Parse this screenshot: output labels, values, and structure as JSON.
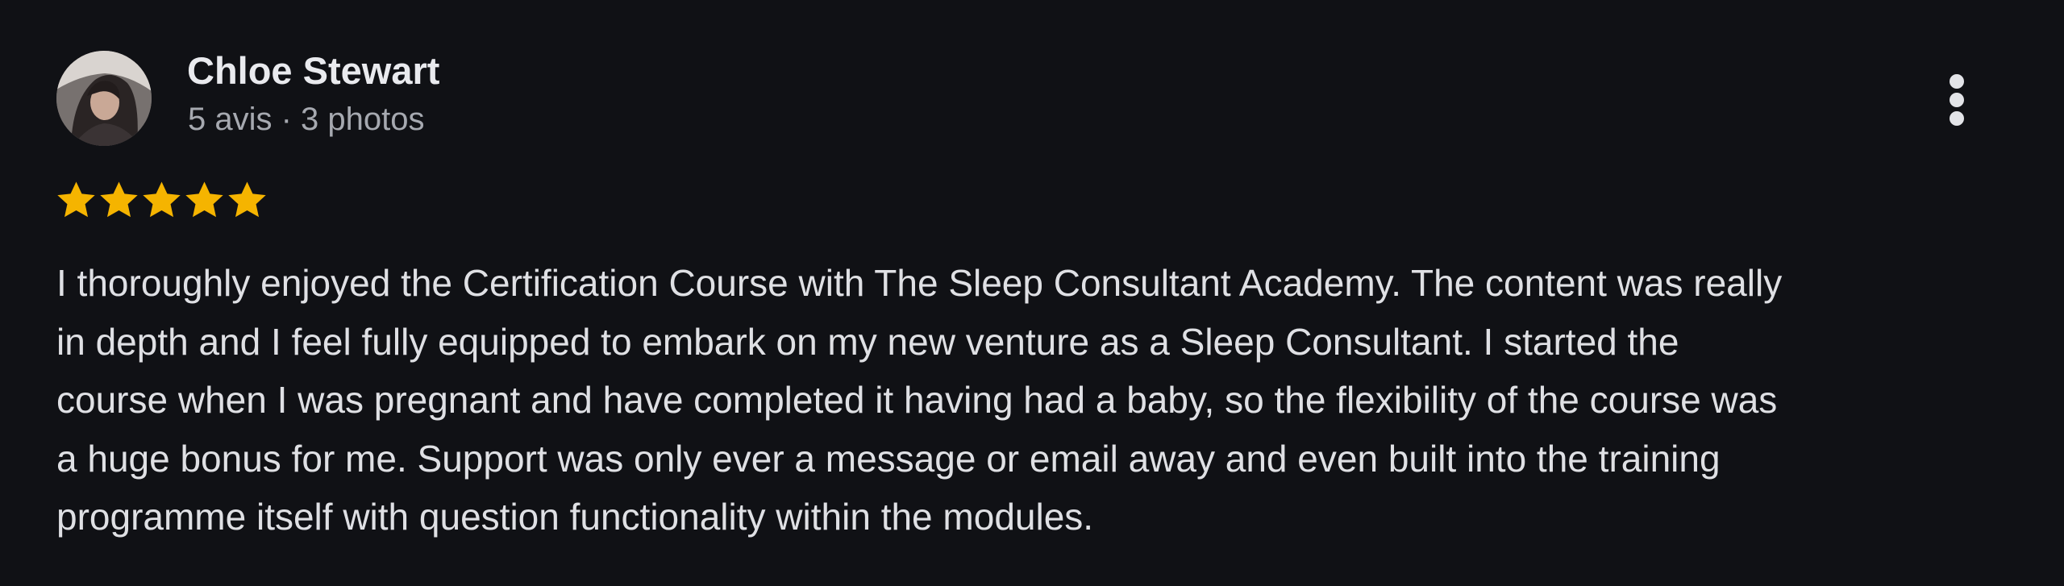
{
  "review": {
    "reviewer": {
      "name": "Chloe Stewart",
      "meta": "5 avis · 3 photos",
      "avatar_icon": "user-photo"
    },
    "rating": {
      "value": 5,
      "max": 5,
      "star_color": "#f5b400"
    },
    "text": "I thoroughly enjoyed the Certification Course with The Sleep Consultant Academy. The content was really\nin depth and I feel fully equipped to embark on my new venture as a Sleep Consultant. I started the\ncourse when I was pregnant and have completed it having had a baby, so the flexibility of the course was\na huge bonus for me. Support was only ever a message or email away and even built into the training\nprogramme itself with question functionality within the modules.",
    "menu_icon": "more-vert-icon"
  },
  "theme": {
    "background": "#101115",
    "name_color": "#e9eaee",
    "meta_color": "#a6a9b0",
    "text_color": "#dfe0e4"
  }
}
